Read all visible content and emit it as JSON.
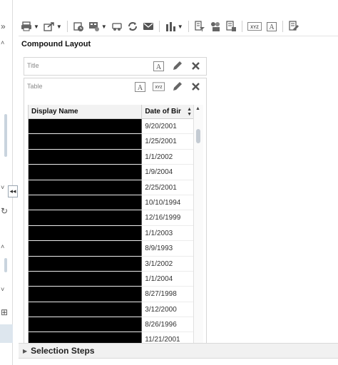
{
  "toolbar": {
    "buttons": [
      {
        "name": "print-icon",
        "has_menu": true
      },
      {
        "name": "export-icon",
        "has_menu": true
      },
      {
        "name": "schedule-icon",
        "has_menu": false
      },
      {
        "name": "prompts-icon",
        "has_menu": true
      },
      {
        "name": "preview-icon",
        "has_menu": false
      },
      {
        "name": "refresh-icon",
        "has_menu": false
      },
      {
        "name": "email-icon",
        "has_menu": false
      },
      {
        "name": "new-view-icon",
        "has_menu": true
      },
      {
        "name": "filters-icon",
        "has_menu": false
      },
      {
        "name": "selectors-icon",
        "has_menu": false
      },
      {
        "name": "calculated-items-icon",
        "has_menu": false
      },
      {
        "name": "column-properties-icon",
        "has_menu": false
      },
      {
        "name": "text-icon",
        "has_menu": false
      },
      {
        "name": "edit-properties-icon",
        "has_menu": false
      }
    ],
    "xyz_label": "XYZ"
  },
  "compound_layout": {
    "title": "Compound Layout"
  },
  "title_view": {
    "label": "Title"
  },
  "table_view": {
    "label": "Table",
    "xyz_label": "XYZ",
    "columns": [
      "Display Name",
      "Date of Birth"
    ],
    "column_display": [
      "Display Name",
      "Date of Bir"
    ],
    "rows": [
      {
        "name": "",
        "date": "9/20/2001"
      },
      {
        "name": "",
        "date": "1/25/2001"
      },
      {
        "name": "",
        "date": "1/1/2002"
      },
      {
        "name": "",
        "date": "1/9/2004"
      },
      {
        "name": "",
        "date": "2/25/2001"
      },
      {
        "name": "",
        "date": "10/10/1994"
      },
      {
        "name": "",
        "date": "12/16/1999"
      },
      {
        "name": "",
        "date": "1/1/2003"
      },
      {
        "name": "",
        "date": "8/9/1993"
      },
      {
        "name": "",
        "date": "3/1/2002"
      },
      {
        "name": "",
        "date": "1/1/2004"
      },
      {
        "name": "",
        "date": "8/27/1998"
      },
      {
        "name": "",
        "date": "3/12/2000"
      },
      {
        "name": "",
        "date": "8/26/1996"
      },
      {
        "name": "",
        "date": "11/21/2001"
      }
    ]
  },
  "selection_steps": {
    "label": "Selection Steps"
  },
  "colors": {
    "redacted_cell": "#000000",
    "panel_border": "#d6d6d6",
    "steps_bar_bg": "#f1f1f1"
  }
}
